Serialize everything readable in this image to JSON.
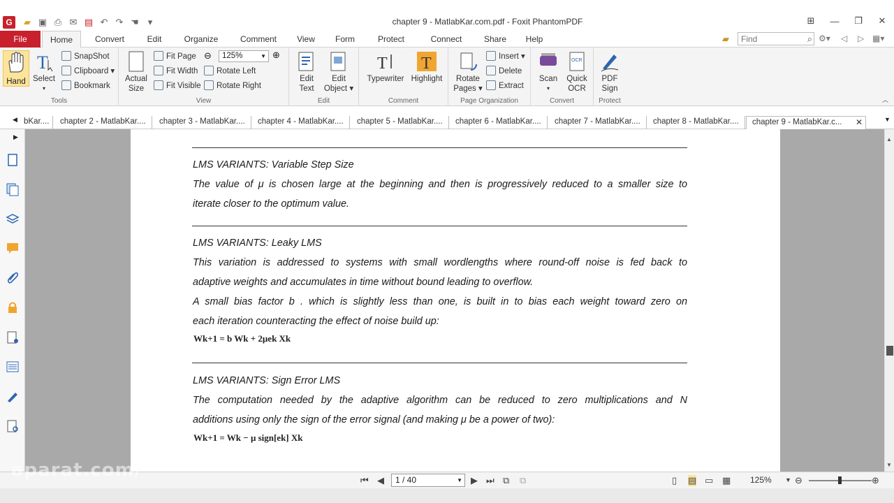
{
  "window": {
    "title": "chapter 9 - MatlabKar.com.pdf - Foxit PhantomPDF",
    "logo_letter": "G"
  },
  "menu": {
    "file": "File",
    "tabs": [
      "Home",
      "Convert",
      "Edit",
      "Organize",
      "Comment",
      "View",
      "Form",
      "Protect",
      "Connect",
      "Share",
      "Help"
    ],
    "active_tab": "Home",
    "find_placeholder": "Find"
  },
  "ribbon": {
    "tools": {
      "label": "Tools",
      "hand": "Hand",
      "select": "Select",
      "snapshot": "SnapShot",
      "clipboard": "Clipboard",
      "bookmark": "Bookmark"
    },
    "view": {
      "label": "View",
      "actual_size_1": "Actual",
      "actual_size_2": "Size",
      "fit_page": "Fit Page",
      "fit_width": "Fit Width",
      "fit_visible": "Fit Visible",
      "zoom": "125%",
      "rotate_left": "Rotate Left",
      "rotate_right": "Rotate Right"
    },
    "edit": {
      "label": "Edit",
      "edit_text_1": "Edit",
      "edit_text_2": "Text",
      "edit_object_1": "Edit",
      "edit_object_2": "Object"
    },
    "comment": {
      "label": "Comment",
      "typewriter": "Typewriter",
      "highlight": "Highlight"
    },
    "page_org": {
      "label": "Page Organization",
      "rotate_pages_1": "Rotate",
      "rotate_pages_2": "Pages",
      "insert": "Insert",
      "delete": "Delete",
      "extract": "Extract"
    },
    "convert": {
      "label": "Convert",
      "scan": "Scan",
      "quick_ocr_1": "Quick",
      "quick_ocr_2": "OCR"
    },
    "protect": {
      "label": "Protect",
      "pdf_sign_1": "PDF",
      "pdf_sign_2": "Sign"
    }
  },
  "doc_tabs": [
    "bKar....",
    "chapter 2 - MatlabKar....",
    "chapter 3 - MatlabKar....",
    "chapter 4 - MatlabKar....",
    "chapter 5 - MatlabKar....",
    "chapter 6 - MatlabKar....",
    "chapter 7 - MatlabKar....",
    "chapter 8 - MatlabKar....",
    "chapter 9 - MatlabKar.c..."
  ],
  "document": {
    "s1_title": "LMS VARIANTS: Variable Step Size",
    "s1_l1": "The value of  μ is chosen large at the beginning and then is progressively reduced to a smaller size to",
    "s1_l2": "iterate closer to the optimum value.",
    "s2_title": "LMS VARIANTS: Leaky LMS",
    "s2_l1": "This variation is addressed to systems with small wordlengths where round-off noise is fed back to",
    "s2_l2": "adaptive weights and accumulates in time without bound leading to overflow.",
    "s2_l3": "A small bias factor b . which is slightly less than one, is built in to bias each weight toward zero on",
    "s2_l4": "each iteration counteracting the effect of noise build up:",
    "s2_formula": "Wk+1 = b Wk + 2μek Xk",
    "s3_title": "LMS VARIANTS: Sign Error LMS",
    "s3_l1": "The computation needed by the adaptive algorithm can be reduced to zero multiplications and N",
    "s3_l2": "additions using only the sign of the error signal (and making μ be a power of two):",
    "s3_formula": "Wk+1 = Wk − μ sign[ek] Xk"
  },
  "status": {
    "page": "1 / 40",
    "zoom": "125%"
  },
  "watermark": "aparat.com/"
}
